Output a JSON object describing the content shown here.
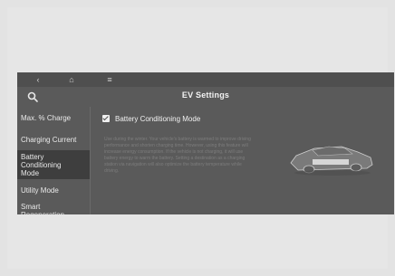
{
  "topbar": {
    "back_icon": "back-arrow-icon",
    "home_icon": "home-icon",
    "menu_icon": "menu-icon"
  },
  "header": {
    "title": "EV Settings",
    "search_icon": "search-icon"
  },
  "sidebar": {
    "items": [
      {
        "label": "Max. % Charge",
        "active": false
      },
      {
        "label": "Charging Current",
        "active": false
      },
      {
        "label": "Battery Conditioning Mode",
        "active": true
      },
      {
        "label": "Utility Mode",
        "active": false
      },
      {
        "label": "Smart Regeneration",
        "active": false
      }
    ]
  },
  "main": {
    "option": {
      "label": "Battery Conditioning Mode",
      "checked": true
    },
    "description": "Use during the winter. Your vehicle's battery is warmed to improve driving performance and shorten charging time. However, using this feature will increase energy consumption. If the vehicle is not charging, it will use battery energy to warm the battery. Setting a destination as a charging station via navigation will also optimize the battery temperature while driving."
  },
  "colors": {
    "screen_bg": "#5a5a5a",
    "topbar_bg": "#4f4f4f",
    "active_item_bg": "#3e3e3e",
    "text": "#f2f2f2",
    "muted_text": "#7d7d7d",
    "outer_bg": "#e3e3e3"
  }
}
